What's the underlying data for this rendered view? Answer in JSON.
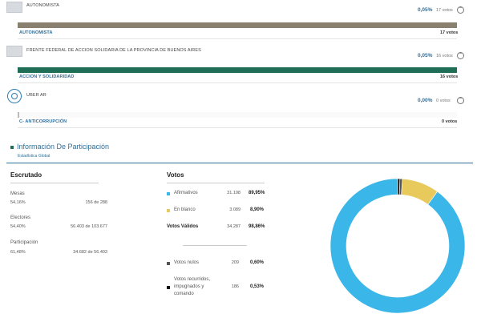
{
  "parties": [
    {
      "name": "AUTONOMISTA",
      "pct": "0,05%",
      "votes": "17 votos",
      "list_name": "AUTONOMISTA",
      "list_votes": "17 votos",
      "bar_color": "#8a8070",
      "bar_fill": 1.0
    },
    {
      "name": "FRENTE FEDERAL DE ACCION SOLIDARIA DE LA PROVINCIA DE BUENOS AIRES",
      "pct": "0,05%",
      "votes": "16 votos",
      "list_name": "ACCION Y SOLIDARIDAD",
      "list_votes": "16 votos",
      "bar_color": "#1f6e56",
      "bar_fill": 1.0
    },
    {
      "name": "UBER AR",
      "pct": "0,00%",
      "votes": "0 votos",
      "list_name": "C- ANTICORRUPCIÓN",
      "list_votes": "0 votos",
      "bar_color": "#e6e6e6",
      "bar_fill": 0.0
    }
  ],
  "participation": {
    "title": "Información De Participación",
    "subtitle": "Estadística Global"
  },
  "escrutado": {
    "heading": "Escrutado",
    "mesas_label": "Mesas",
    "mesas_pct": "54,16%",
    "mesas_count": "156 de 288",
    "electores_label": "Electores",
    "electores_pct": "54,40%",
    "electores_count": "56.403 de 103.677",
    "participacion_label": "Participación",
    "participacion_pct": "61,48%",
    "participacion_count": "34.682 de 56.403"
  },
  "votos": {
    "heading": "Votos",
    "afirmativos_label": "Afirmativos",
    "afirmativos_count": "31.198",
    "afirmativos_pct": "89,95%",
    "blanco_label": "En blanco",
    "blanco_count": "3.089",
    "blanco_pct": "8,90%",
    "validos_label": "Votos Válidos",
    "validos_count": "34.287",
    "validos_pct": "98,86%",
    "nulos_label": "Votos nulos",
    "nulos_count": "209",
    "nulos_pct": "0,60%",
    "recurridos_label_1": "Votos recurridos,",
    "recurridos_label_2": "impugnados y",
    "recurridos_label_3": "comando",
    "recurridos_count": "186",
    "recurridos_pct": "0,53%"
  },
  "colors": {
    "afirmativos": "#3bb6e8",
    "blanco": "#e8c95b",
    "nulos": "#555555",
    "recurridos": "#111111"
  },
  "donut": {
    "afirmativos": 89.95,
    "blanco": 8.9,
    "nulos": 0.6,
    "recurridos": 0.53
  }
}
